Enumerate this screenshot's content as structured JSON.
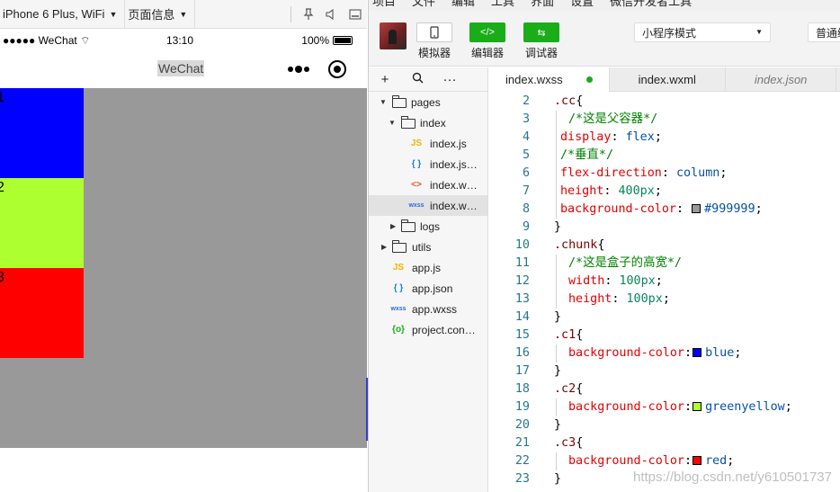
{
  "simulator": {
    "device": "iPhone 6 Plus, WiFi",
    "page_info": "页面信息",
    "status": {
      "carrier": "●●●●● WeChat",
      "time": "13:10",
      "battery": "100%"
    },
    "nav_title": "WeChat",
    "chunks": [
      {
        "label": "1",
        "color": "#0000ff"
      },
      {
        "label": "2",
        "color": "#adff2f"
      },
      {
        "label": "3",
        "color": "#ff0000"
      }
    ],
    "container_color": "#999999"
  },
  "ide": {
    "menu": [
      "项目",
      "文件",
      "编辑",
      "工具",
      "界面",
      "设置",
      "微信开发者工具"
    ],
    "toolbar": {
      "simulator": "模拟器",
      "editor": "编辑器",
      "debugger": "调试器",
      "mode": "小程序模式",
      "compile": "普通编译"
    },
    "tabs": [
      {
        "label": "index.wxss",
        "modified": true
      },
      {
        "label": "index.wxml"
      },
      {
        "label": "index.json"
      }
    ],
    "tree": [
      {
        "name": "pages",
        "type": "folder",
        "open": true
      },
      {
        "name": "index",
        "type": "folder",
        "open": true
      },
      {
        "name": "index.js",
        "type": "js",
        "icon": "JS"
      },
      {
        "name": "index.js…",
        "type": "json",
        "icon": "{ }"
      },
      {
        "name": "index.w…",
        "type": "wxml",
        "icon": "<>"
      },
      {
        "name": "index.w…",
        "type": "wxss",
        "icon": "wxss"
      },
      {
        "name": "logs",
        "type": "folder",
        "open": false
      },
      {
        "name": "utils",
        "type": "folder",
        "open": false
      },
      {
        "name": "app.js",
        "type": "js",
        "icon": "JS"
      },
      {
        "name": "app.json",
        "type": "json",
        "icon": "{ }"
      },
      {
        "name": "app.wxss",
        "type": "wxss",
        "icon": "wxss"
      },
      {
        "name": "project.con…",
        "type": "cfg",
        "icon": "{o}"
      }
    ],
    "code_lines": [
      {
        "n": "2",
        "parts": [
          [
            "sel",
            ".cc"
          ],
          [
            "plain",
            "{"
          ]
        ]
      },
      {
        "n": "3",
        "parts": [
          [
            "cmt",
            "/*这是父容器*/"
          ]
        ],
        "indent": 2
      },
      {
        "n": "4",
        "parts": [
          [
            "prop",
            "display"
          ],
          [
            "plain",
            ": "
          ],
          [
            "val",
            "flex"
          ],
          [
            "plain",
            ";"
          ]
        ],
        "indent": 1
      },
      {
        "n": "5",
        "parts": [
          [
            "cmt",
            "/*垂直*/"
          ]
        ],
        "indent": 1
      },
      {
        "n": "6",
        "parts": [
          [
            "prop",
            "flex-direction"
          ],
          [
            "plain",
            ": "
          ],
          [
            "val",
            "column"
          ],
          [
            "plain",
            ";"
          ]
        ],
        "indent": 1
      },
      {
        "n": "7",
        "parts": [
          [
            "prop",
            "height"
          ],
          [
            "plain",
            ": "
          ],
          [
            "num",
            "400px"
          ],
          [
            "plain",
            ";"
          ]
        ],
        "indent": 1
      },
      {
        "n": "8",
        "parts": [
          [
            "prop",
            "background-color"
          ],
          [
            "plain",
            ": "
          ],
          [
            "swatch",
            "#999999"
          ],
          [
            "val",
            "#999999"
          ],
          [
            "plain",
            ";"
          ]
        ],
        "indent": 1
      },
      {
        "n": "9",
        "parts": [
          [
            "plain",
            "}"
          ]
        ]
      },
      {
        "n": "10",
        "parts": [
          [
            "sel",
            ".chunk"
          ],
          [
            "plain",
            "{"
          ]
        ]
      },
      {
        "n": "11",
        "parts": [
          [
            "cmt",
            "/*这是盒子的高宽*/"
          ]
        ],
        "indent": 2
      },
      {
        "n": "12",
        "parts": [
          [
            "prop",
            "width"
          ],
          [
            "plain",
            ": "
          ],
          [
            "num",
            "100px"
          ],
          [
            "plain",
            ";"
          ]
        ],
        "indent": 2
      },
      {
        "n": "13",
        "parts": [
          [
            "prop",
            "height"
          ],
          [
            "plain",
            ": "
          ],
          [
            "num",
            "100px"
          ],
          [
            "plain",
            ";"
          ]
        ],
        "indent": 2
      },
      {
        "n": "14",
        "parts": [
          [
            "plain",
            "}"
          ]
        ]
      },
      {
        "n": "15",
        "parts": [
          [
            "sel",
            ".c1"
          ],
          [
            "plain",
            "{"
          ]
        ]
      },
      {
        "n": "16",
        "parts": [
          [
            "prop",
            "background-color"
          ],
          [
            "plain",
            ":"
          ],
          [
            "swatch",
            "#0000ff"
          ],
          [
            "val",
            "blue"
          ],
          [
            "plain",
            ";"
          ]
        ],
        "indent": 2
      },
      {
        "n": "17",
        "parts": [
          [
            "plain",
            "}"
          ]
        ]
      },
      {
        "n": "18",
        "parts": [
          [
            "sel",
            ".c2"
          ],
          [
            "plain",
            "{"
          ]
        ]
      },
      {
        "n": "19",
        "parts": [
          [
            "prop",
            "background-color"
          ],
          [
            "plain",
            ":"
          ],
          [
            "swatch",
            "#adff2f"
          ],
          [
            "val",
            "greenyellow"
          ],
          [
            "plain",
            ";"
          ]
        ],
        "indent": 2
      },
      {
        "n": "20",
        "parts": [
          [
            "plain",
            "}"
          ]
        ]
      },
      {
        "n": "21",
        "parts": [
          [
            "sel",
            ".c3"
          ],
          [
            "plain",
            "{"
          ]
        ]
      },
      {
        "n": "22",
        "parts": [
          [
            "prop",
            "background-color"
          ],
          [
            "plain",
            ":"
          ],
          [
            "swatch",
            "#ff0000"
          ],
          [
            "val",
            "red"
          ],
          [
            "plain",
            ";"
          ]
        ],
        "indent": 2
      },
      {
        "n": "23",
        "parts": [
          [
            "plain",
            "}"
          ]
        ]
      }
    ],
    "watermark": "https://blog.csdn.net/y610501737"
  }
}
